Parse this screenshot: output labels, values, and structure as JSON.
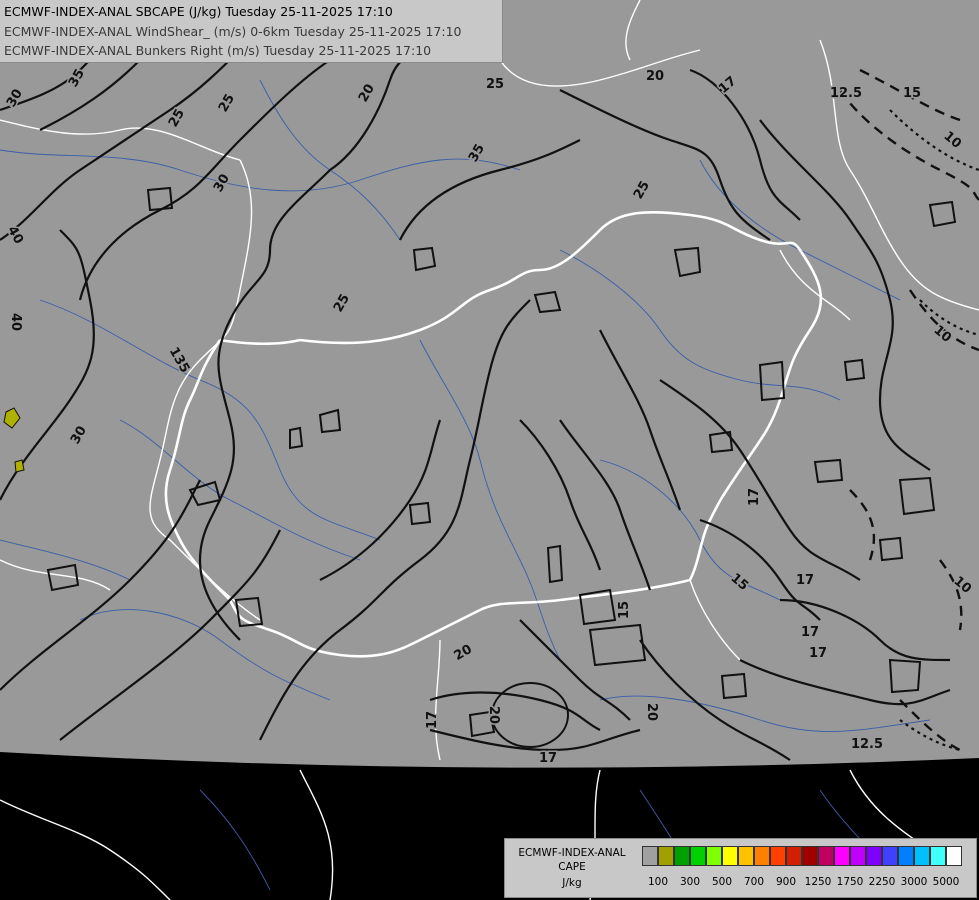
{
  "header": {
    "line1": "ECMWF-INDEX-ANAL SBCAPE (J/kg) Tuesday 25-11-2025 17:10",
    "line2": "ECMWF-INDEX-ANAL WindShear_ (m/s) 0-6km Tuesday 25-11-2025 17:10",
    "line3": "ECMWF-INDEX-ANAL Bunkers Right (m/s) Tuesday 25-11-2025 17:10"
  },
  "legend": {
    "title_line1": "ECMWF-INDEX-ANAL",
    "title_line2": "CAPE",
    "title_line3": "J/kg",
    "colors": [
      "#a0a0a0",
      "#a0a000",
      "#00a000",
      "#00d000",
      "#80ff00",
      "#ffff00",
      "#ffc000",
      "#ff8000",
      "#ff4000",
      "#d02000",
      "#a00000",
      "#c00060",
      "#ff00ff",
      "#c000ff",
      "#8000ff",
      "#4040ff",
      "#0080ff",
      "#00c0ff",
      "#40ffff",
      "#ffffff"
    ],
    "ticks": [
      "100",
      "300",
      "500",
      "700",
      "900",
      "1250",
      "1750",
      "2250",
      "3000",
      "5000"
    ]
  },
  "map": {
    "colors": {
      "data_area": "#999999",
      "outside": "#000000",
      "border": "#ffffff",
      "river": "#3a5ea8",
      "contour": "#111111",
      "cape_low": "#b0b000"
    },
    "contour_labels": [
      "35",
      "30",
      "25",
      "20",
      "25",
      "30",
      "35",
      "25",
      "25",
      "40",
      "40",
      "30",
      "135",
      "25",
      "20",
      "17",
      "12.5",
      "15",
      "10",
      "10",
      "17",
      "15",
      "17",
      "17",
      "10",
      "15",
      "20",
      "20",
      "17",
      "12.5",
      "17",
      "17",
      "20"
    ]
  }
}
